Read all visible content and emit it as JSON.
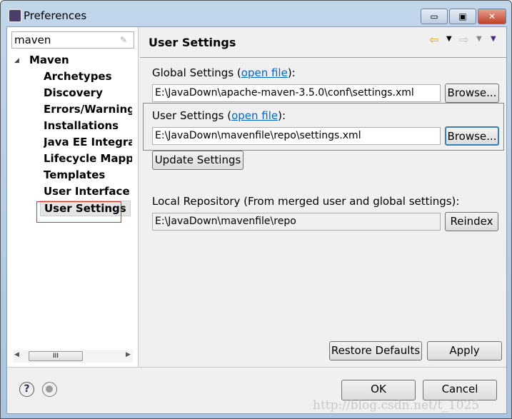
{
  "window": {
    "title": "Preferences",
    "minimize": "▭",
    "maximize": "▣",
    "close": "✕"
  },
  "sidebar": {
    "search_value": "maven",
    "root": "Maven",
    "items": [
      "Archetypes",
      "Discovery",
      "Errors/Warnings",
      "Installations",
      "Java EE Integration",
      "Lifecycle Mapping",
      "Templates",
      "User Interface",
      "User Settings"
    ],
    "selected": "User Settings",
    "scroll_thumb": "III"
  },
  "page": {
    "title": "User Settings",
    "global_label": "Global Settings (",
    "global_link": "open file",
    "global_end": "):",
    "global_value": "E:\\JavaDown\\apache-maven-3.5.0\\conf\\settings.xml",
    "browse": "Browse...",
    "user_label": "User Settings (",
    "user_link": "open file",
    "user_end": "):",
    "user_value": "E:\\JavaDown\\mavenfile\\repo\\settings.xml",
    "update": "Update Settings",
    "local_label": "Local Repository (From merged user and global settings):",
    "local_value": "E:\\JavaDown\\mavenfile\\repo",
    "reindex": "Reindex",
    "restore": "Restore Defaults",
    "apply": "Apply"
  },
  "footer": {
    "ok": "OK",
    "cancel": "Cancel",
    "help": "?"
  },
  "watermark": "http://blog.csdn.net/t_1025",
  "colors": {
    "link": "#0066cc",
    "highlight_box": "#e03030"
  }
}
